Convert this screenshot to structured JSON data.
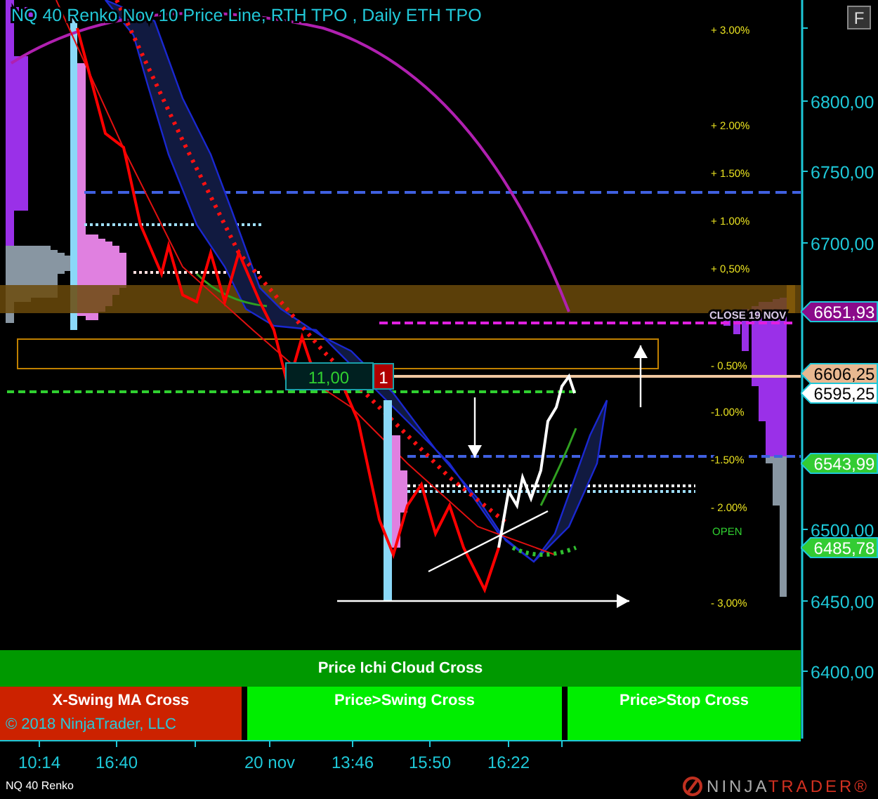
{
  "chart": {
    "title": "NQ 40 Renko Nov 10 Price Line, RTH TPO , Daily ETH TPO",
    "format_button": "F",
    "percent_labels": [
      "+ 3.00%",
      "+ 2.00%",
      "+ 1.50%",
      "+ 1.00%",
      "+ 0,50%",
      "- 0.50%",
      "-1.00%",
      "-1.50%",
      "- 2.00%",
      "- 3,00%"
    ],
    "open_label": "OPEN",
    "close_label": "CLOSE 19 NOV",
    "position": {
      "quantity": "11,00",
      "count": "1"
    },
    "price_tags": [
      {
        "text": "6651,93",
        "color": "#8a0a8a"
      },
      {
        "text": "6606,25",
        "color": "#e8b890"
      },
      {
        "text": "6595,25",
        "color": "#ffffff"
      },
      {
        "text": "6543,99",
        "color": "#33cc33"
      },
      {
        "text": "6485,78",
        "color": "#33cc33"
      }
    ],
    "axis_labels": [
      "6800,00",
      "6750,00",
      "6700,00",
      "6500,00",
      "6450,00",
      "6400,00"
    ],
    "time_labels": [
      "10:14",
      "16:40",
      "20 nov",
      "13:46",
      "15:50",
      "16:22"
    ]
  },
  "signals": {
    "top": {
      "label": "Price Ichi Cloud Cross",
      "color": "#009900"
    },
    "bottom": [
      {
        "label": "X-Swing MA Cross",
        "color": "#cc2200"
      },
      {
        "label": "Price>Swing Cross",
        "color": "#00ee00"
      },
      {
        "label": "Price>Stop Cross",
        "color": "#00ee00"
      }
    ]
  },
  "copyright": "© 2018 NinjaTrader, LLC",
  "footer": {
    "instrument": "NQ 40 Renko",
    "logo_left": "NINJA",
    "logo_right": "TRADER®"
  }
}
